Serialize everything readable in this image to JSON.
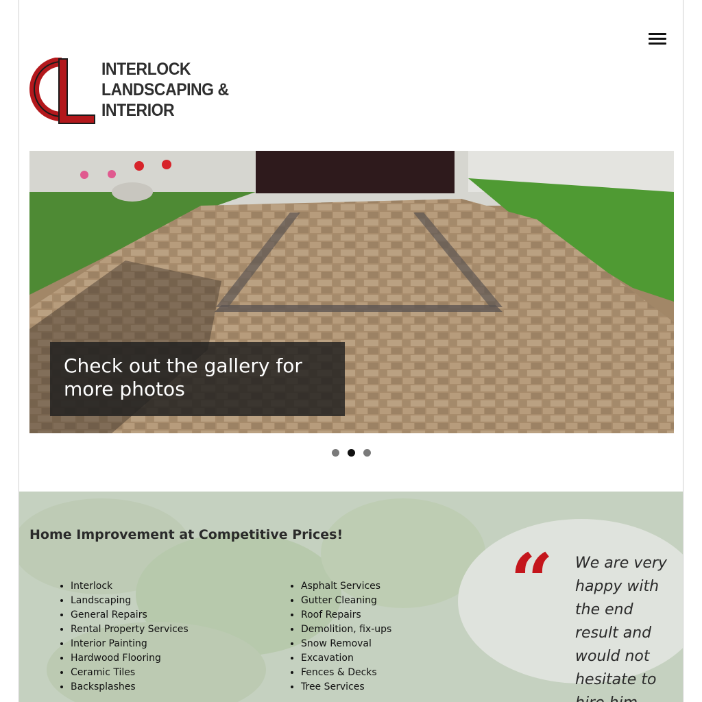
{
  "header": {
    "menu_icon": "hamburger-menu-icon",
    "logo": {
      "line1": "INTERLOCK",
      "line2": "LANDSCAPING &",
      "line3": "INTERIOR",
      "brand_red": "#b3181c",
      "brand_dark": "#2e2e2e"
    }
  },
  "slider": {
    "caption": "Check out the gallery for more photos",
    "slide_count": 3,
    "active_slide": 2
  },
  "services": {
    "title": "Home Improvement at Competitive Prices!",
    "column1": [
      "Interlock",
      "Landscaping",
      "General Repairs",
      "Rental Property Services",
      "Interior Painting",
      "Hardwood Flooring",
      "Ceramic Tiles",
      "Backsplashes"
    ],
    "column2": [
      "Asphalt Services",
      "Gutter Cleaning",
      "Roof Repairs",
      "Demolition, fix-ups",
      "Snow Removal",
      "Excavation",
      "Fences & Decks",
      "Tree Services"
    ]
  },
  "testimonial": {
    "quote_mark": "“",
    "text": "We are very happy with the end result and would not hesitate to hire him",
    "accent_color": "#c4161c"
  }
}
